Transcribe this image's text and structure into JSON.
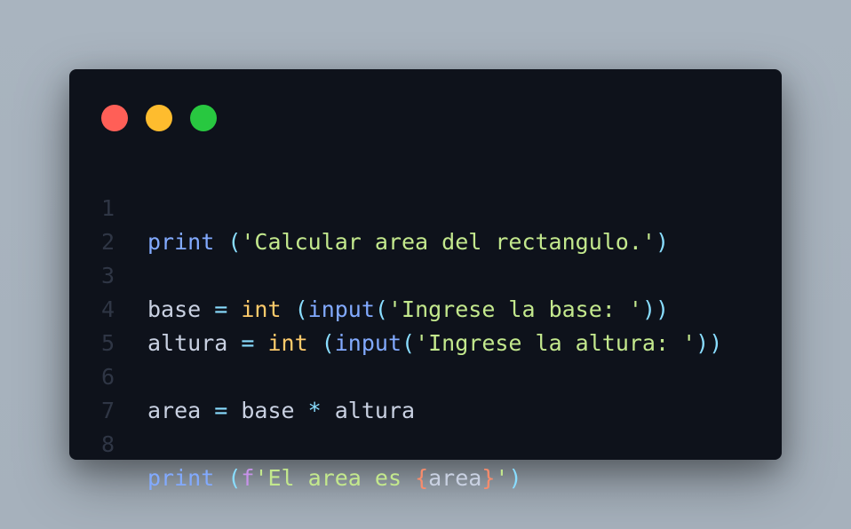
{
  "window": {
    "controls": {
      "close_color": "#ff5f57",
      "minimize_color": "#febc2e",
      "maximize_color": "#28c840"
    }
  },
  "code": {
    "lines": [
      {
        "number": "1"
      },
      {
        "number": "2"
      },
      {
        "number": "3"
      },
      {
        "number": "4"
      },
      {
        "number": "5"
      },
      {
        "number": "6"
      },
      {
        "number": "7"
      },
      {
        "number": "8"
      }
    ],
    "tokens": {
      "l1": {
        "print": "print",
        "open": " (",
        "str": "'Calcular area del rectangulo.'",
        "close": ")"
      },
      "l3": {
        "var": "base",
        "eq": " = ",
        "int": "int",
        "open": " (",
        "input": "input",
        "open2": "(",
        "str": "'Ingrese la base: '",
        "close": "))"
      },
      "l4": {
        "var": "altura",
        "eq": " = ",
        "int": "int",
        "open": " (",
        "input": "input",
        "open2": "(",
        "str": "'Ingrese la altura: '",
        "close": "))"
      },
      "l6": {
        "var": "area",
        "eq": " = ",
        "base": "base",
        "mul": " * ",
        "altura": "altura"
      },
      "l8": {
        "print": "print",
        "open": " (",
        "f": "f",
        "str1": "'El area es ",
        "lbrace": "{",
        "var": "area",
        "rbrace": "}",
        "str2": "'",
        "close": ")"
      }
    }
  }
}
